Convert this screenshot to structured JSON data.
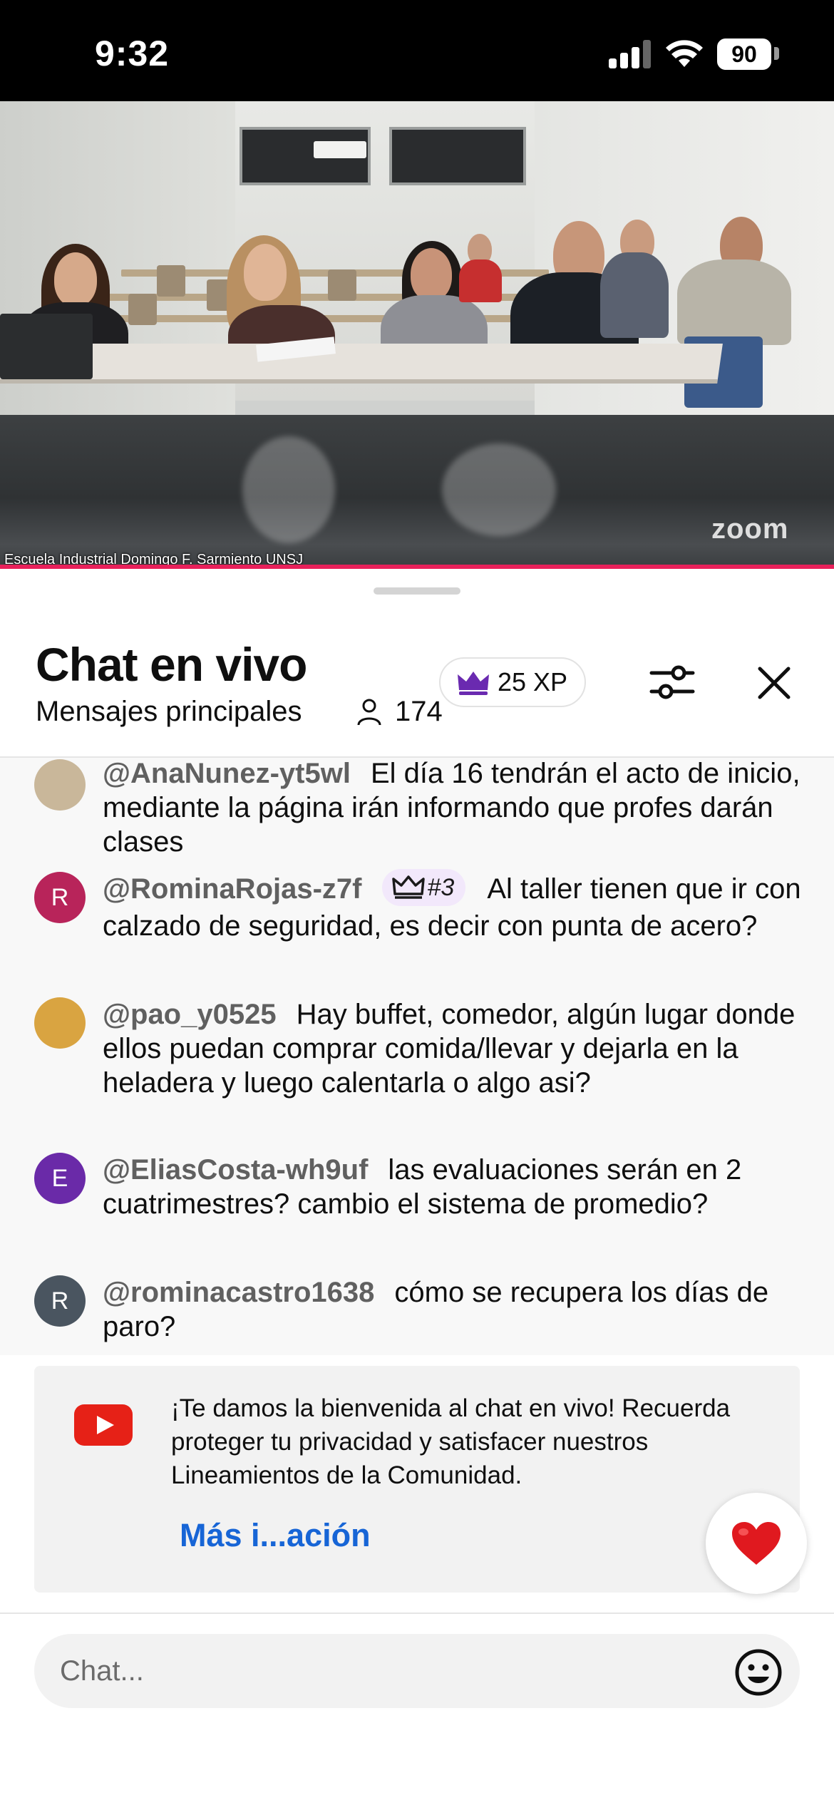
{
  "status_bar": {
    "time": "9:32",
    "battery": "90"
  },
  "video": {
    "caption": "Escuela Industrial Domingo F. Sarmiento UNSJ",
    "watermark": "zoom"
  },
  "chat_header": {
    "title": "Chat en vivo",
    "subtitle": "Mensajes principales",
    "viewer_count": "174",
    "xp_label": "25 XP"
  },
  "messages": [
    {
      "author": "@AnaNunez-yt5wl",
      "text": "El día 16 tendrán el acto de inicio, mediante la página irán informando que profes darán clases",
      "avatar_initial": "",
      "avatar_color": "#c9b79a"
    },
    {
      "author": "@RominaRojas-z7f",
      "badge": "#3",
      "text": "Al taller tienen que ir con calzado de seguridad, es decir con punta de acero?",
      "avatar_initial": "R",
      "avatar_color": "#b8245a"
    },
    {
      "author": "@pao_y0525",
      "text": "Hay buffet, comedor, algún lugar donde ellos puedan comprar comida/llevar y dejarla en la heladera y luego calentarla o algo asi?",
      "avatar_initial": "",
      "avatar_color": "#d9a441"
    },
    {
      "author": "@EliasCosta-wh9uf",
      "text": "las evaluaciones serán en 2 cuatrimestres? cambio el sistema de promedio?",
      "avatar_initial": "E",
      "avatar_color": "#6a2aa8"
    },
    {
      "author": "@rominacastro1638",
      "text": "cómo se recupera los días de paro?",
      "avatar_initial": "R",
      "avatar_color": "#4a5560"
    }
  ],
  "welcome": {
    "text": "¡Te damos la bienvenida al chat en vivo! Recuerda proteger tu privacidad y satisfacer nuestros Lineamientos de la Comunidad.",
    "link": "Más i...ación"
  },
  "input": {
    "placeholder": "Chat..."
  },
  "colors": {
    "accent_red": "#e8205a",
    "link_blue": "#1765d6",
    "youtube_red": "#e62117",
    "crown_purple": "#6a2ab0"
  },
  "icons": [
    "crown-icon",
    "sliders-icon",
    "close-icon",
    "person-icon",
    "youtube-icon",
    "heart-icon",
    "emoji-icon"
  ]
}
